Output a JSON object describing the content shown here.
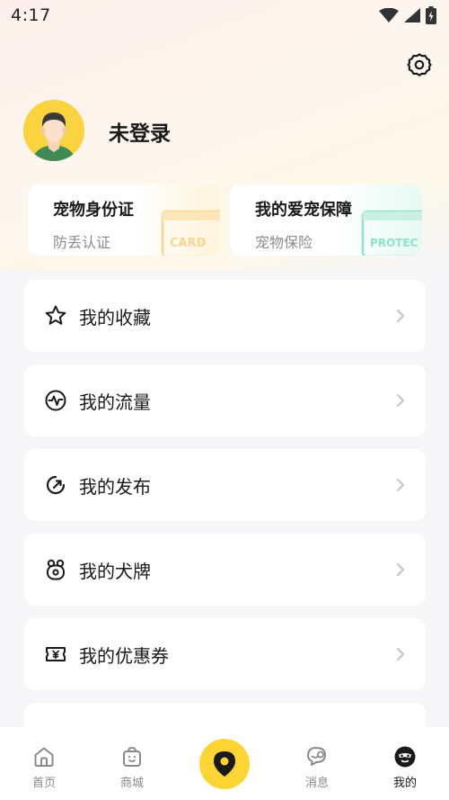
{
  "status_bar": {
    "time": "4:17"
  },
  "profile": {
    "username": "未登录"
  },
  "promo_cards": [
    {
      "title": "宠物身份证",
      "subtitle": "防丢认证",
      "deco_text": "CARD",
      "accent": "#fbd98a"
    },
    {
      "title": "我的爱宠保障",
      "subtitle": "宠物保险",
      "deco_text": "PROTEC",
      "accent": "#8ee3c4"
    }
  ],
  "menu": [
    {
      "label": "我的收藏",
      "icon": "star-icon"
    },
    {
      "label": "我的流量",
      "icon": "activity-icon"
    },
    {
      "label": "我的发布",
      "icon": "publish-icon"
    },
    {
      "label": "我的犬牌",
      "icon": "dog-tag-icon"
    },
    {
      "label": "我的优惠券",
      "icon": "coupon-icon"
    }
  ],
  "tabbar": [
    {
      "label": "首页",
      "icon": "home-icon",
      "active": false
    },
    {
      "label": "商城",
      "icon": "shop-icon",
      "active": false
    },
    {
      "label": "消息",
      "icon": "message-icon",
      "active": false
    },
    {
      "label": "我的",
      "icon": "profile-icon",
      "active": true
    }
  ],
  "colors": {
    "accent_yellow": "#fcd433",
    "text_primary": "#1a1a1a",
    "text_secondary": "#8c8c8c"
  }
}
